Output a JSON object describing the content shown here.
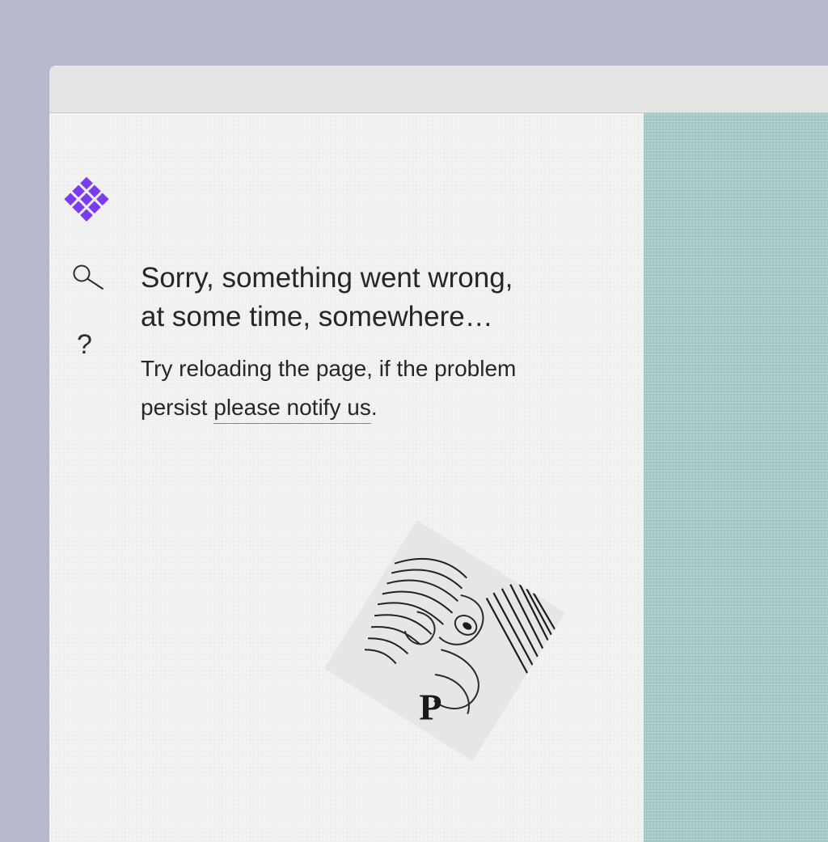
{
  "colors": {
    "background": "#b7b9cc",
    "titlebar": "#e4e4e4",
    "main_pane": "#f0f0f0",
    "side_pane": "#a7cbc9",
    "logo": "#7b3cf0",
    "text": "#262626"
  },
  "sidebar": {
    "logo_icon": "purple-diamond-grid-logo",
    "items": [
      {
        "icon": "search-icon"
      },
      {
        "icon": "help-icon",
        "glyph": "?"
      }
    ]
  },
  "error": {
    "heading_line1": "Sorry, something went wrong,",
    "heading_line2": "at some time, somewhere…",
    "message_line1": "Try reloading the page, if the problem",
    "message_prefix": "persist ",
    "message_link": "please notify us",
    "message_suffix": "."
  },
  "illustration": {
    "icon": "engraving-illustration",
    "letter": "P"
  }
}
